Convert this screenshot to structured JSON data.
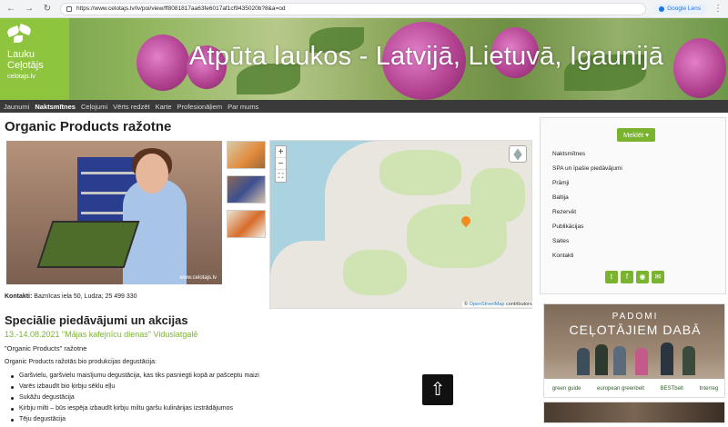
{
  "browser": {
    "url": "https://www.celotajs.lv/lv/poi/view/ff8081817aa63fe6017af1cf9435020b?8&a=od",
    "lens_label": "Google Lens"
  },
  "banner": {
    "logo_line1": "Lauku",
    "logo_line2": "Ceļotājs",
    "logo_line3": "celotajs.lv",
    "title": "Atpūta laukos - Latvijā, Lietuvā, Igaunijā"
  },
  "menu": [
    {
      "label": "Jaunumi",
      "active": false
    },
    {
      "label": "Naktsmītnes",
      "active": true
    },
    {
      "label": "Ceļojumi",
      "active": false
    },
    {
      "label": "Vērts redzēt",
      "active": false
    },
    {
      "label": "Karte",
      "active": false
    },
    {
      "label": "Profesionāļiem",
      "active": false
    },
    {
      "label": "Par mums",
      "active": false
    }
  ],
  "page": {
    "title": "Organic Products ražotne",
    "photo_watermark": "www.celotajs.lv",
    "contacts_label": "Kontakti:",
    "contacts_value": "Baznīcas iela 50, Ludza; 25 499 330",
    "map_attrib_symbol": "©",
    "map_attrib_link": "OpenStreetMap",
    "map_attrib_tail": "contributors",
    "special_title": "Speciālie piedāvājumi un akcijas",
    "event_title": "13.-14.08.2021 \"Mājas kafejnīcu dienas\" Viduslatgalē",
    "event_subtitle": "\"Organic Products\" ražotne",
    "event_desc": "Organic Products ražotās bio produkcijas degustācija:",
    "event_items": [
      "Garšvielu, garšvielu maisījumu degustācija, kas tiks pasniegti kopā ar pašceptu maizi",
      "Varēs izbaudīt bio ķirbju sēklu eļļu",
      "Sukāžu degustācija",
      "Ķirbju milti – būs iespēja izbaudīt ķirbju miltu garšu kulinārijas izstrādājumos",
      "Tēju degustācija"
    ]
  },
  "sidebar": {
    "search_button": "Meklēt",
    "links": [
      "Naktsmītnes",
      "SPA un īpašie piedāvājumi",
      "Prāmji",
      "Baltija",
      "Rezervēt",
      "Publikācijas",
      "Saites",
      "Kontakti"
    ],
    "social_icons": [
      "twitter-icon",
      "facebook-icon",
      "rss-icon",
      "email-icon"
    ]
  },
  "ad": {
    "line1": "PADOMI",
    "line2": "CEĻOTĀJIEM DABĀ",
    "partners": [
      "green guide",
      "european greenbelt",
      "BESTbelt",
      "Interreg"
    ]
  },
  "colors": {
    "accent": "#7ab32f",
    "menubar": "#3a3a3a"
  }
}
